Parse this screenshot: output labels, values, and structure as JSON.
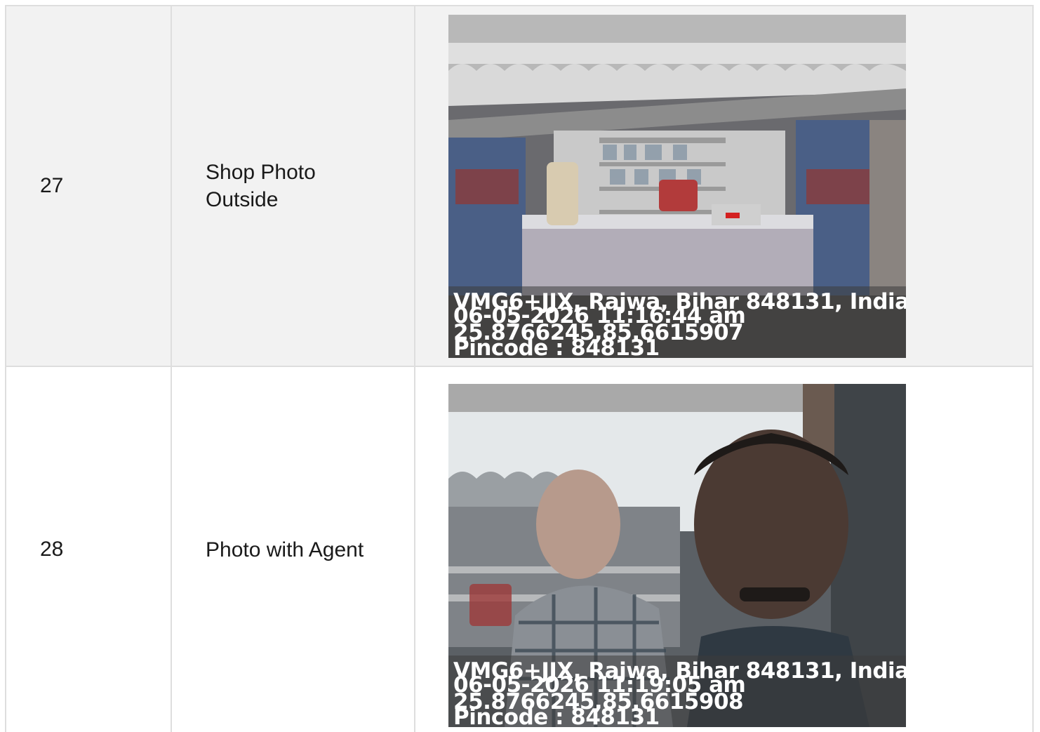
{
  "rows": [
    {
      "number": "27",
      "label": "Shop Photo Outside",
      "photo": {
        "icon": "shop-storefront-photo",
        "address": "VMG6+JJX, Rajwa, Bihar 848131, India ...",
        "timestamp": "06-05-2026 11:16:44 am",
        "coordinates": "25.8766245,85.6615907",
        "pincode": "Pincode : 848131"
      }
    },
    {
      "number": "28",
      "label": "Photo with Agent",
      "photo": {
        "icon": "agent-selfie-photo",
        "address": "VMG6+JJX, Rajwa, Bihar 848131, India ...",
        "timestamp": "06-05-2026 11:19:05 am",
        "coordinates": "25.8766245,85.6615908",
        "pincode": "Pincode : 848131"
      }
    }
  ],
  "colors": {
    "row_alt_bg": "#f2f2f2",
    "row_bg": "#ffffff",
    "border": "#dedede",
    "overlay_text": "#ffffff"
  }
}
